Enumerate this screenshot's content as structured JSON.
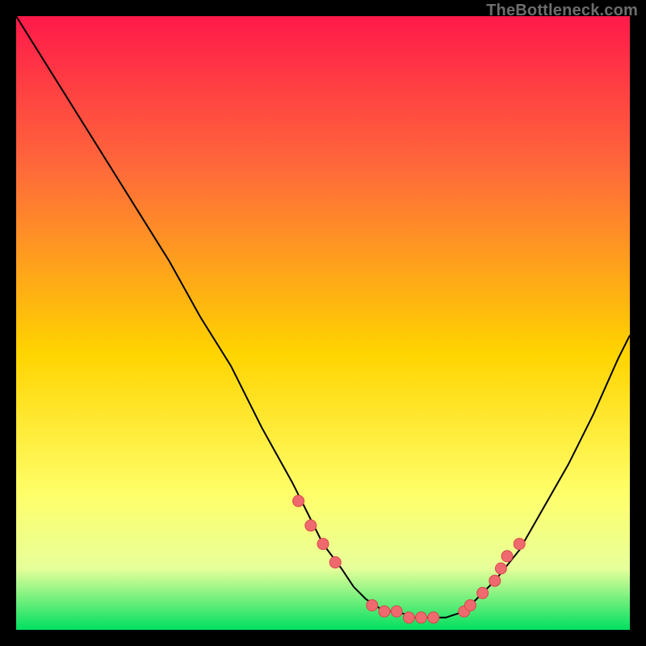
{
  "watermark": "TheBottleneck.com",
  "colors": {
    "gradient_top": "#ff1a4a",
    "gradient_mid_upper": "#ff6a3a",
    "gradient_mid": "#ffd400",
    "gradient_low": "#ffff6a",
    "gradient_lower": "#e7ff9a",
    "gradient_bottom": "#00e060",
    "curve": "#000000",
    "point_fill": "#ef6a6e",
    "point_stroke": "#d9484c",
    "background": "#000000"
  },
  "chart_data": {
    "type": "line",
    "title": "",
    "xlabel": "",
    "ylabel": "",
    "xlim": [
      0,
      100
    ],
    "ylim": [
      0,
      100
    ],
    "grid": false,
    "legend": false,
    "series": [
      {
        "name": "bottleneck-curve",
        "x": [
          0,
          5,
          10,
          15,
          20,
          25,
          30,
          35,
          40,
          45,
          48,
          50,
          53,
          55,
          57,
          60,
          62,
          65,
          68,
          70,
          73,
          75,
          78,
          82,
          86,
          90,
          94,
          98,
          100
        ],
        "y": [
          100,
          92,
          84,
          76,
          68,
          60,
          51,
          43,
          33,
          24,
          18,
          14,
          10,
          7,
          5,
          3,
          3,
          2,
          2,
          2,
          3,
          5,
          8,
          13,
          20,
          27,
          35,
          44,
          48
        ]
      }
    ],
    "points": {
      "name": "marked-points",
      "x": [
        46,
        48,
        50,
        52,
        58,
        60,
        62,
        64,
        66,
        68,
        73,
        74,
        76,
        78,
        79,
        80,
        82
      ],
      "y": [
        21,
        17,
        14,
        11,
        4,
        3,
        3,
        2,
        2,
        2,
        3,
        4,
        6,
        8,
        10,
        12,
        14
      ]
    }
  }
}
